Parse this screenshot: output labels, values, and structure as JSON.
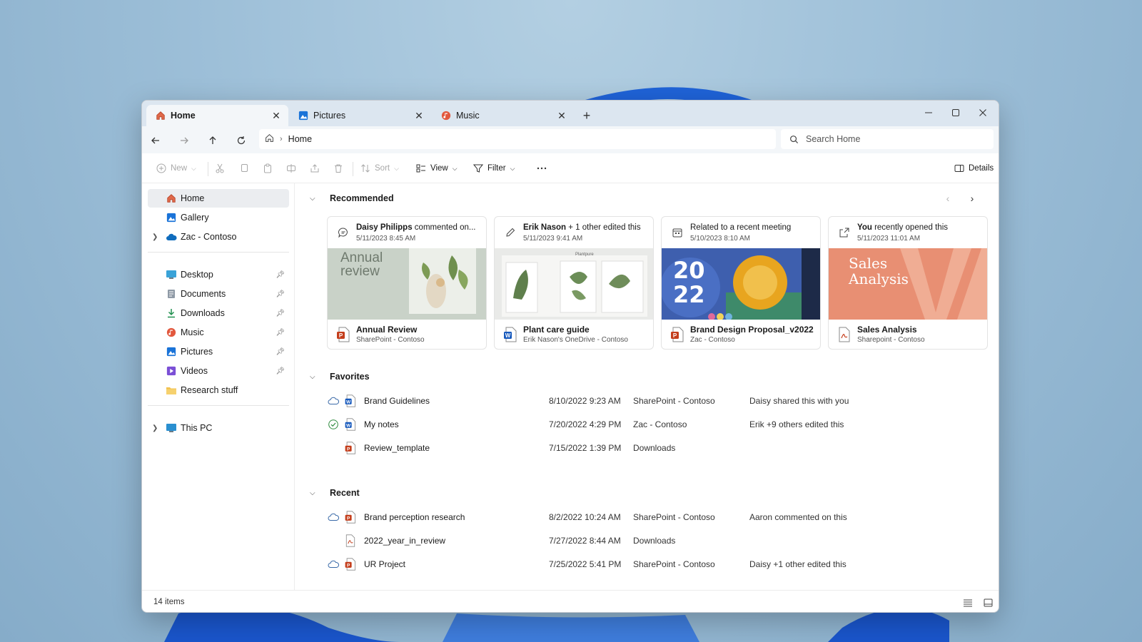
{
  "tabs": [
    {
      "label": "Home",
      "icon": "home-icon",
      "active": true
    },
    {
      "label": "Pictures",
      "icon": "pictures-icon",
      "active": false
    },
    {
      "label": "Music",
      "icon": "music-icon",
      "active": false
    }
  ],
  "address": {
    "breadcrumb": "Home",
    "search_placeholder": "Search Home"
  },
  "toolbar": {
    "new_label": "New",
    "sort_label": "Sort",
    "view_label": "View",
    "filter_label": "Filter",
    "details_label": "Details"
  },
  "sidebar": {
    "top": [
      {
        "label": "Home",
        "icon": "home-icon"
      },
      {
        "label": "Gallery",
        "icon": "gallery-icon"
      },
      {
        "label": "Zac - Contoso",
        "icon": "onedrive-cloud-icon"
      }
    ],
    "pinned": [
      {
        "label": "Desktop",
        "icon": "desktop-icon"
      },
      {
        "label": "Documents",
        "icon": "documents-icon"
      },
      {
        "label": "Downloads",
        "icon": "downloads-icon"
      },
      {
        "label": "Music",
        "icon": "music-icon"
      },
      {
        "label": "Pictures",
        "icon": "pictures-icon"
      },
      {
        "label": "Videos",
        "icon": "videos-icon"
      },
      {
        "label": "Research stuff",
        "icon": "folder-icon"
      }
    ],
    "this_pc": "This PC"
  },
  "recommended": {
    "title": "Recommended",
    "cards": [
      {
        "actor": "Daisy Philipps",
        "action": " commented on...",
        "time": "5/11/2023 8:45 AM",
        "name": "Annual Review",
        "location": "SharePoint - Contoso",
        "thumb_text": "Annual review",
        "activity_icon": "comment-icon",
        "file_icon": "powerpoint-file-icon"
      },
      {
        "actor": "Erik Nason",
        "action": " + 1 other edited this",
        "time": "5/11/2023 9:41 AM",
        "name": "Plant care guide",
        "location": "Erik Nason's OneDrive - Contoso",
        "thumb_text": "Plantpure",
        "activity_icon": "pencil-icon",
        "file_icon": "word-file-icon"
      },
      {
        "actor": "",
        "action": "Related to a recent meeting",
        "time": "5/10/2023 8:10 AM",
        "name": "Brand Design Proposal_v2022",
        "location": "Zac - Contoso",
        "thumb_text": "20 22",
        "activity_icon": "calendar-icon",
        "file_icon": "powerpoint-file-icon"
      },
      {
        "actor": "You",
        "action": " recently opened this",
        "time": "5/11/2023 11:01 AM",
        "name": "Sales Analysis",
        "location": "Sharepoint - Contoso",
        "thumb_text": "Sales Analysis",
        "activity_icon": "open-icon",
        "file_icon": "pdf-file-icon"
      }
    ]
  },
  "favorites": {
    "title": "Favorites",
    "rows": [
      {
        "name": "Brand Guidelines",
        "date": "8/10/2022 9:23 AM",
        "location": "SharePoint - Contoso",
        "activity": "Daisy shared this with you",
        "status": "cloud",
        "type": "word"
      },
      {
        "name": "My notes",
        "date": "7/20/2022 4:29 PM",
        "location": "Zac - Contoso",
        "activity": "Erik +9 others edited this",
        "status": "synced",
        "type": "word"
      },
      {
        "name": "Review_template",
        "date": "7/15/2022 1:39 PM",
        "location": "Downloads",
        "activity": "",
        "status": "",
        "type": "powerpoint"
      }
    ]
  },
  "recent": {
    "title": "Recent",
    "rows": [
      {
        "name": "Brand perception research",
        "date": "8/2/2022 10:24 AM",
        "location": "SharePoint - Contoso",
        "activity": "Aaron commented on this",
        "status": "cloud",
        "type": "powerpoint"
      },
      {
        "name": "2022_year_in_review",
        "date": "7/27/2022 8:44 AM",
        "location": "Downloads",
        "activity": "",
        "status": "",
        "type": "pdf"
      },
      {
        "name": "UR Project",
        "date": "7/25/2022 5:41 PM",
        "location": "SharePoint - Contoso",
        "activity": "Daisy +1 other edited this",
        "status": "cloud",
        "type": "powerpoint"
      }
    ]
  },
  "status": {
    "item_count": "14 items"
  },
  "colors": {
    "accent": "#0067c0",
    "powerpoint": "#c43e1c",
    "word": "#185abd",
    "synced_green": "#2e8b3e"
  }
}
